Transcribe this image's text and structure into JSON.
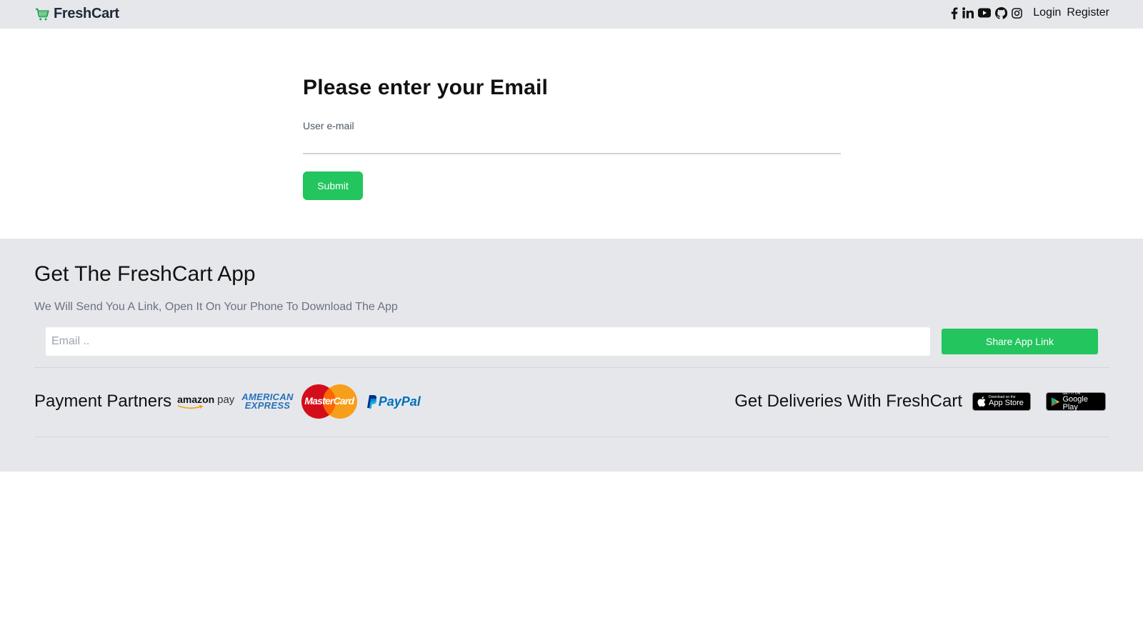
{
  "navbar": {
    "brand": "FreshCart",
    "social_icons": [
      "facebook-icon",
      "linkedin-icon",
      "youtube-icon",
      "github-icon",
      "instagram-icon"
    ],
    "login": "Login",
    "register": "Register"
  },
  "form": {
    "heading": "Please enter your Email",
    "email_label": "User e-mail",
    "email_value": "",
    "submit": "Submit"
  },
  "footer": {
    "title": "Get The FreshCart App",
    "subtitle": "We Will Send You A Link, Open It On Your Phone To Download The App",
    "email_placeholder": "Email ..",
    "share_button": "Share App Link",
    "payment_title": "Payment Partners",
    "payment_logos": {
      "amazon": "amazon",
      "amazon_pay": "pay",
      "amex_line1": "AMERICAN",
      "amex_line2": "EXPRESS",
      "mastercard": "MasterCard",
      "paypal": "PayPal"
    },
    "deliveries_title": "Get Deliveries With FreshCart",
    "app_store": {
      "small": "Download on the",
      "big": "App Store"
    },
    "google_play": {
      "small": "GET IT ON",
      "big": "Google Play"
    }
  },
  "colors": {
    "accent": "#22c55e",
    "navbar_bg": "#e5e7eb",
    "footer_bg": "#e5e7eb"
  }
}
